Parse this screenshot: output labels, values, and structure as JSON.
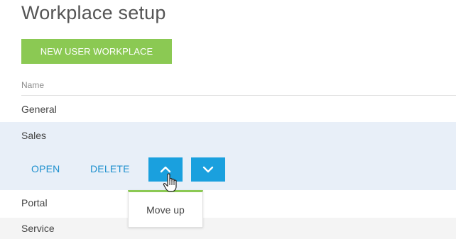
{
  "page": {
    "title": "Workplace setup"
  },
  "toolbar": {
    "new_label": "NEW USER WORKPLACE"
  },
  "table": {
    "column_header": "Name",
    "rows": [
      "General",
      "Sales",
      "Portal",
      "Service"
    ]
  },
  "row_actions": {
    "open_label": "OPEN",
    "delete_label": "DELETE",
    "up_icon": "chevron-up-icon",
    "down_icon": "chevron-down-icon"
  },
  "tooltip": {
    "text": "Move up"
  },
  "colors": {
    "accent_green": "#8bc953",
    "accent_blue": "#1aa0de",
    "link_blue": "#1e90ce",
    "selected_row": "#e8eff8"
  }
}
